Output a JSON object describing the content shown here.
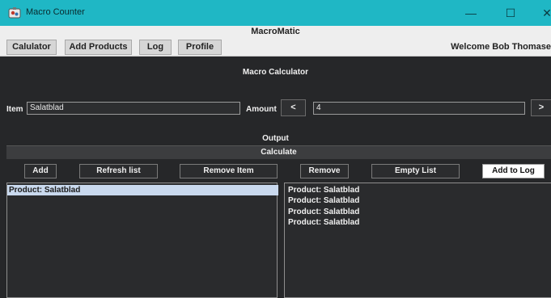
{
  "window": {
    "title": "Macro Counter",
    "controls": {
      "minimize": "—",
      "maximize": "☐",
      "close": "✕"
    }
  },
  "app": {
    "name": "MacroMatic"
  },
  "nav": {
    "tabs": [
      "Calulator",
      "Add Products",
      "Log",
      "Profile"
    ],
    "welcome": "Welcome Bob Thomase"
  },
  "calculator": {
    "title": "Macro Calculator",
    "item_label": "Item",
    "item_value": "Salatblad",
    "amount_label": "Amount",
    "decrement_label": "<",
    "amount_value": "4",
    "increment_label": ">",
    "output_label": "Output",
    "calculate_label": "Calculate"
  },
  "actions": {
    "add": "Add",
    "refresh": "Refresh list",
    "remove_item": "Remove Item",
    "remove": "Remove",
    "empty_list": "Empty List",
    "add_to_log": "Add to Log"
  },
  "products_list": [
    "Product: Salatblad"
  ],
  "output_list": [
    "Product: Salatblad",
    "Product: Salatblad",
    "Product: Salatblad",
    "Product: Salatblad"
  ],
  "colors": {
    "title_bar": "#1fb7c5",
    "panel": "#262729",
    "selection": "#c9d9ee"
  }
}
